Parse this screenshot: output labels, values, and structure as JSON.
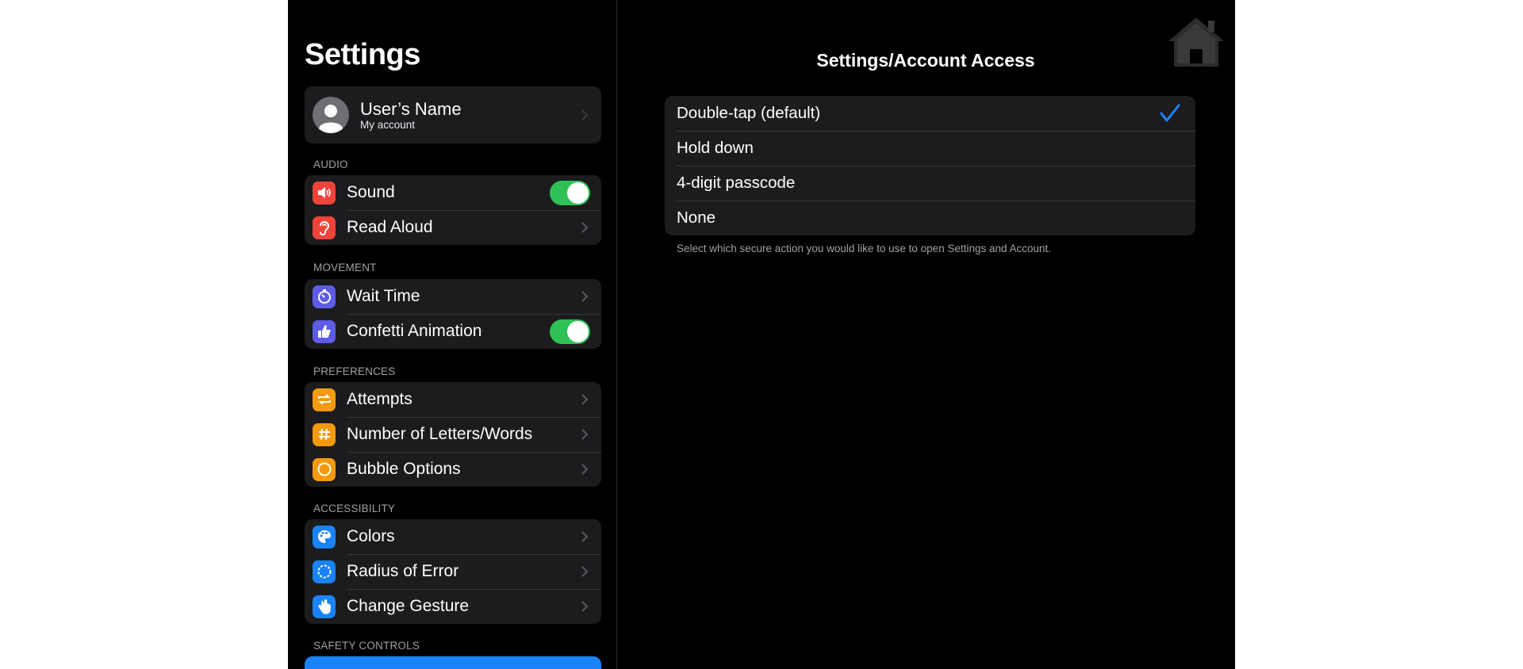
{
  "sidebar": {
    "title": "Settings",
    "user": {
      "name": "User’s Name",
      "subtitle": "My account"
    },
    "sections": {
      "audio": {
        "label": "AUDIO",
        "sound": "Sound",
        "read_aloud": "Read Aloud"
      },
      "movement": {
        "label": "MOVEMENT",
        "wait_time": "Wait Time",
        "confetti": "Confetti Animation"
      },
      "preferences": {
        "label": "PREFERENCES",
        "attempts": "Attempts",
        "letters_words": "Number of Letters/Words",
        "bubble": "Bubble Options"
      },
      "accessibility": {
        "label": "ACCESSIBILITY",
        "colors": "Colors",
        "radius": "Radius of Error",
        "gesture": "Change Gesture"
      },
      "safety": {
        "label": "SAFETY CONTROLS"
      }
    },
    "toggles": {
      "sound": true,
      "confetti": true
    }
  },
  "detail": {
    "title": "Settings/Account Access",
    "options": [
      "Double-tap (default)",
      "Hold down",
      "4-digit passcode",
      "None"
    ],
    "selected_index": 0,
    "footnote": "Select which secure action you would like to use to open Settings and Account."
  },
  "colors": {
    "background": "#000000",
    "group": "#1c1c1e",
    "toggle_on": "#30c156",
    "accent_blue": "#1a82fb",
    "icon_red": "#f0433a",
    "icon_purple": "#5e5ce6",
    "icon_orange": "#f59a0c",
    "icon_blue": "#1a82fb"
  }
}
